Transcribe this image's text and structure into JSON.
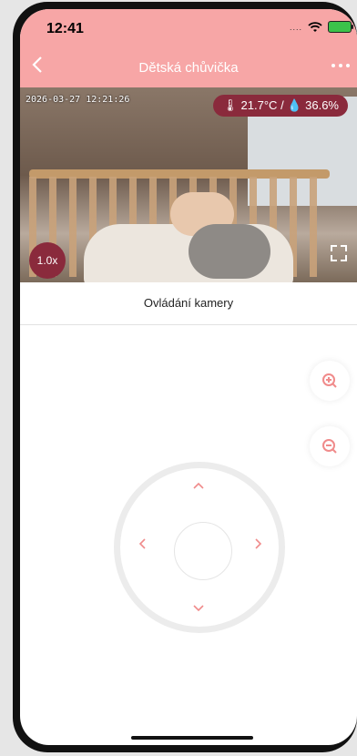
{
  "status_bar": {
    "time": "12:41",
    "dots": "....",
    "battery_color": "#3cc24a"
  },
  "header": {
    "title": "Dětská chůvička",
    "back_icon": "chevron-left-icon",
    "more_icon": "more-horizontal-icon",
    "accent": "#f7a6a6"
  },
  "video": {
    "timestamp": "2026-03-27 12:21:26",
    "sensor": {
      "temperature": "21.7°C",
      "separator": "/",
      "humidity": "36.6%"
    },
    "zoom_level": "1.0x",
    "fullscreen_icon": "fullscreen-icon"
  },
  "camera_controls": {
    "title": "Ovládání kamery",
    "zoom_in_icon": "zoom-in-icon",
    "zoom_out_icon": "zoom-out-icon",
    "dpad": {
      "up_icon": "chevron-up-icon",
      "down_icon": "chevron-down-icon",
      "left_icon": "chevron-left-icon",
      "right_icon": "chevron-right-icon",
      "arrow_color": "#f08b8b"
    }
  }
}
